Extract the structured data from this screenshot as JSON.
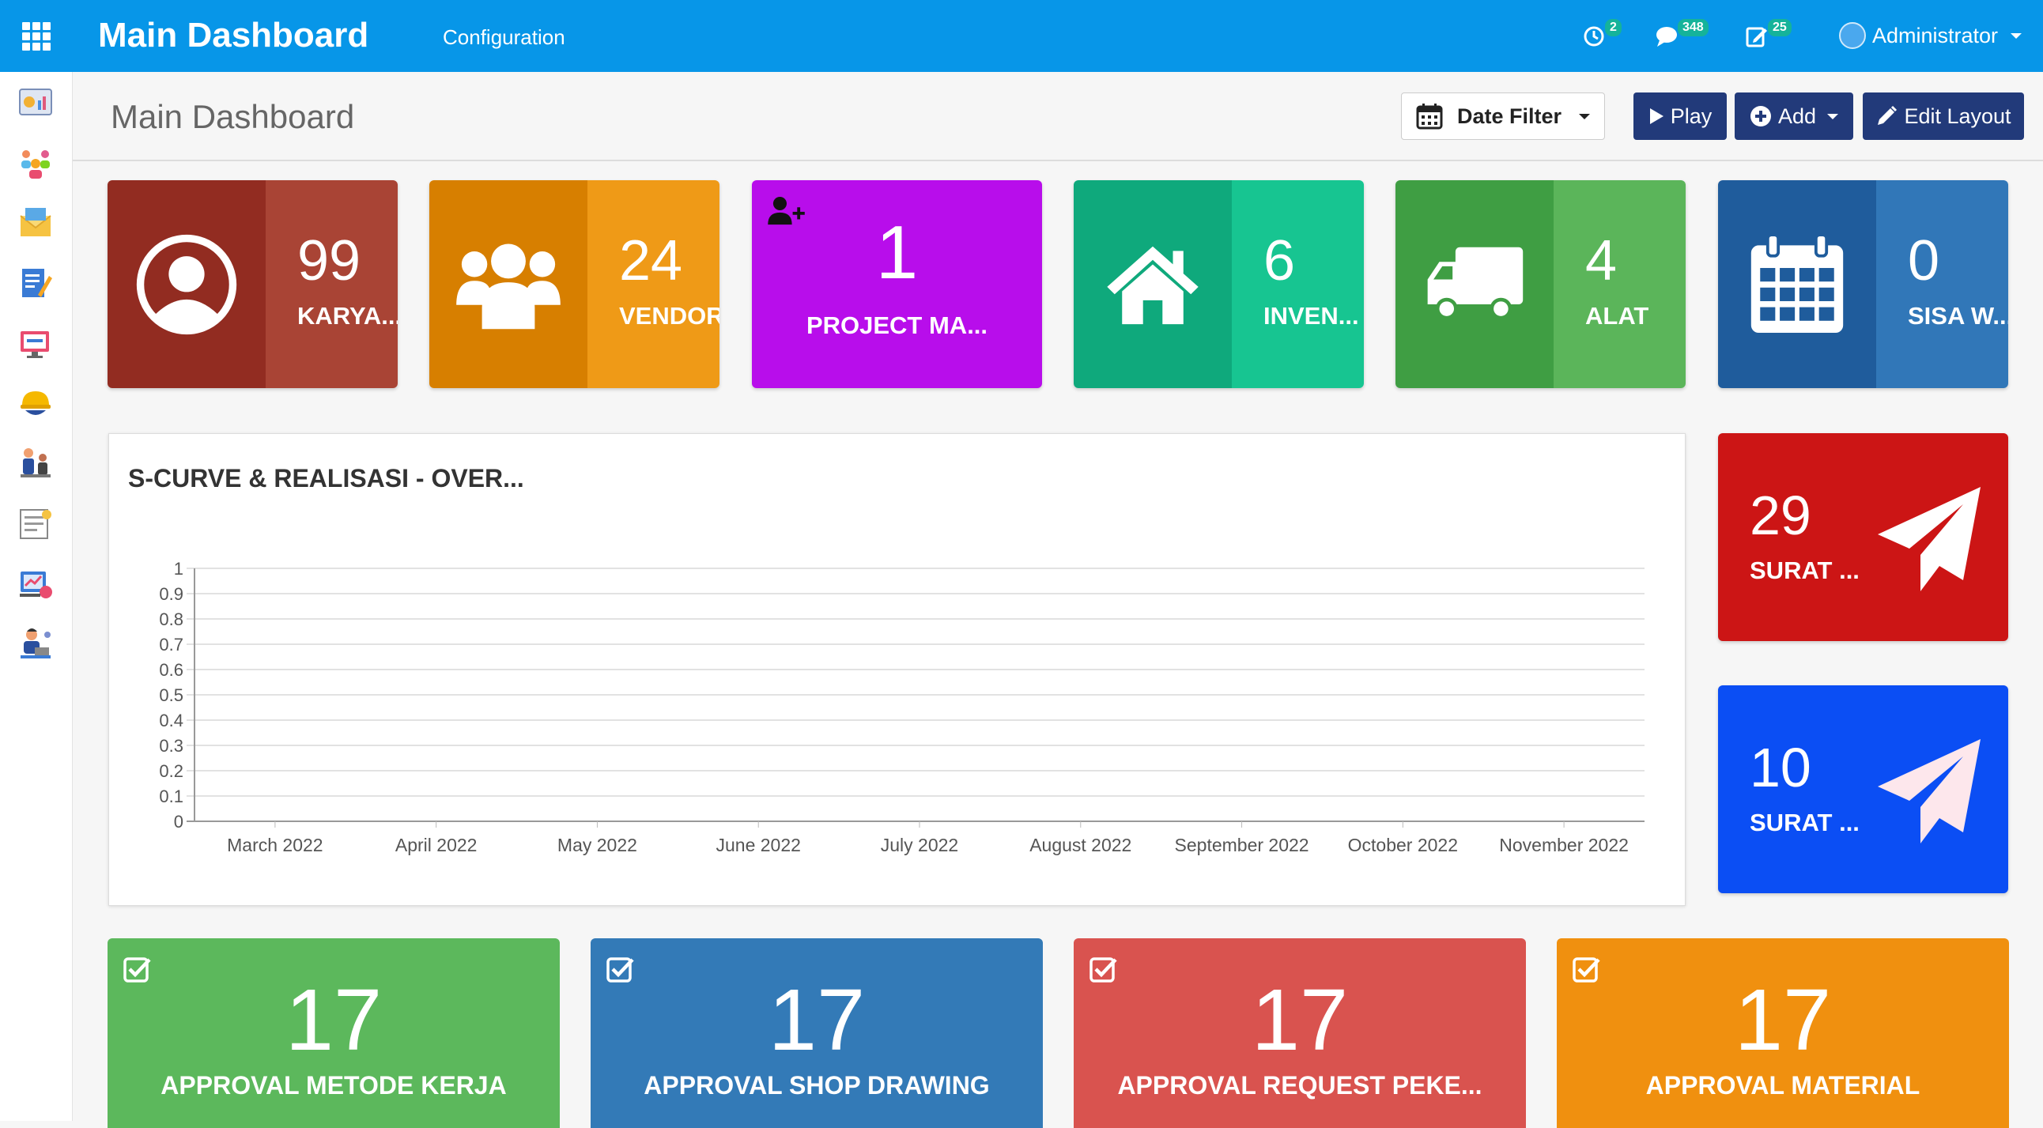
{
  "header": {
    "brand": "Main Dashboard",
    "nav": [
      "Configuration"
    ],
    "notifications": [
      {
        "icon": "history-icon",
        "count": "2"
      },
      {
        "icon": "chat-icon",
        "count": "348"
      },
      {
        "icon": "edit-note-icon",
        "count": "25"
      }
    ],
    "user": "Administrator"
  },
  "sidebar": {
    "items": [
      "dashboard-icon",
      "team-icon",
      "mail-icon",
      "document-edit-icon",
      "monitor-icon",
      "worker-helmet-icon",
      "meeting-icon",
      "report-icon",
      "analytics-icon",
      "user-laptop-icon"
    ]
  },
  "page": {
    "title": "Main Dashboard",
    "date_filter_label": "Date Filter",
    "play_label": "Play",
    "add_label": "Add",
    "edit_layout_label": "Edit Layout"
  },
  "stats": [
    {
      "value": "99",
      "label": "KARYA...",
      "icon": "user-circle-icon",
      "left_color": "#922c21",
      "right_color": "#a94435"
    },
    {
      "value": "24",
      "label": "VENDOR",
      "icon": "users-group-icon",
      "left_color": "#d77f00",
      "right_color": "#ef9a17"
    },
    {
      "value": "1",
      "label": "PROJECT MA...",
      "icon": "user-plus-icon",
      "left_color": "#b80deb",
      "right_color": "#b80deb"
    },
    {
      "value": "6",
      "label": "INVEN...",
      "icon": "home-icon",
      "left_color": "#0fa97c",
      "right_color": "#17c591"
    },
    {
      "value": "4",
      "label": "ALAT",
      "icon": "truck-icon",
      "left_color": "#3f9e43",
      "right_color": "#5bb55a"
    },
    {
      "value": "0",
      "label": "SISA W...",
      "icon": "calendar-icon",
      "left_color": "#1f5c9c",
      "right_color": "#3177b8"
    }
  ],
  "chart_data": {
    "type": "line",
    "title": "S-CURVE & REALISASI - OVER...",
    "categories": [
      "March 2022",
      "April 2022",
      "May 2022",
      "June 2022",
      "July 2022",
      "August 2022",
      "September 2022",
      "October 2022",
      "November 2022"
    ],
    "y_ticks": [
      "1",
      "0.9",
      "0.8",
      "0.7",
      "0.6",
      "0.5",
      "0.4",
      "0.3",
      "0.2",
      "0.1",
      "0"
    ],
    "series": [],
    "ylim": [
      0,
      1
    ],
    "grid": true
  },
  "surat": [
    {
      "value": "29",
      "label": "SURAT ...",
      "color": "#cc1515",
      "icon": "paper-plane-icon",
      "icon_color": "#ffffff"
    },
    {
      "value": "10",
      "label": "SURAT ...",
      "color": "#0b4ef4",
      "icon": "paper-plane-icon",
      "icon_color": "#fde7ec"
    }
  ],
  "approvals": [
    {
      "value": "17",
      "label": "APPROVAL METODE KERJA",
      "color": "#5cb85c"
    },
    {
      "value": "17",
      "label": "APPROVAL SHOP DRAWING",
      "color": "#337ab7"
    },
    {
      "value": "17",
      "label": "APPROVAL REQUEST PEKE...",
      "color": "#d9534f"
    },
    {
      "value": "17",
      "label": "APPROVAL MATERIAL",
      "color": "#f0900f"
    }
  ]
}
